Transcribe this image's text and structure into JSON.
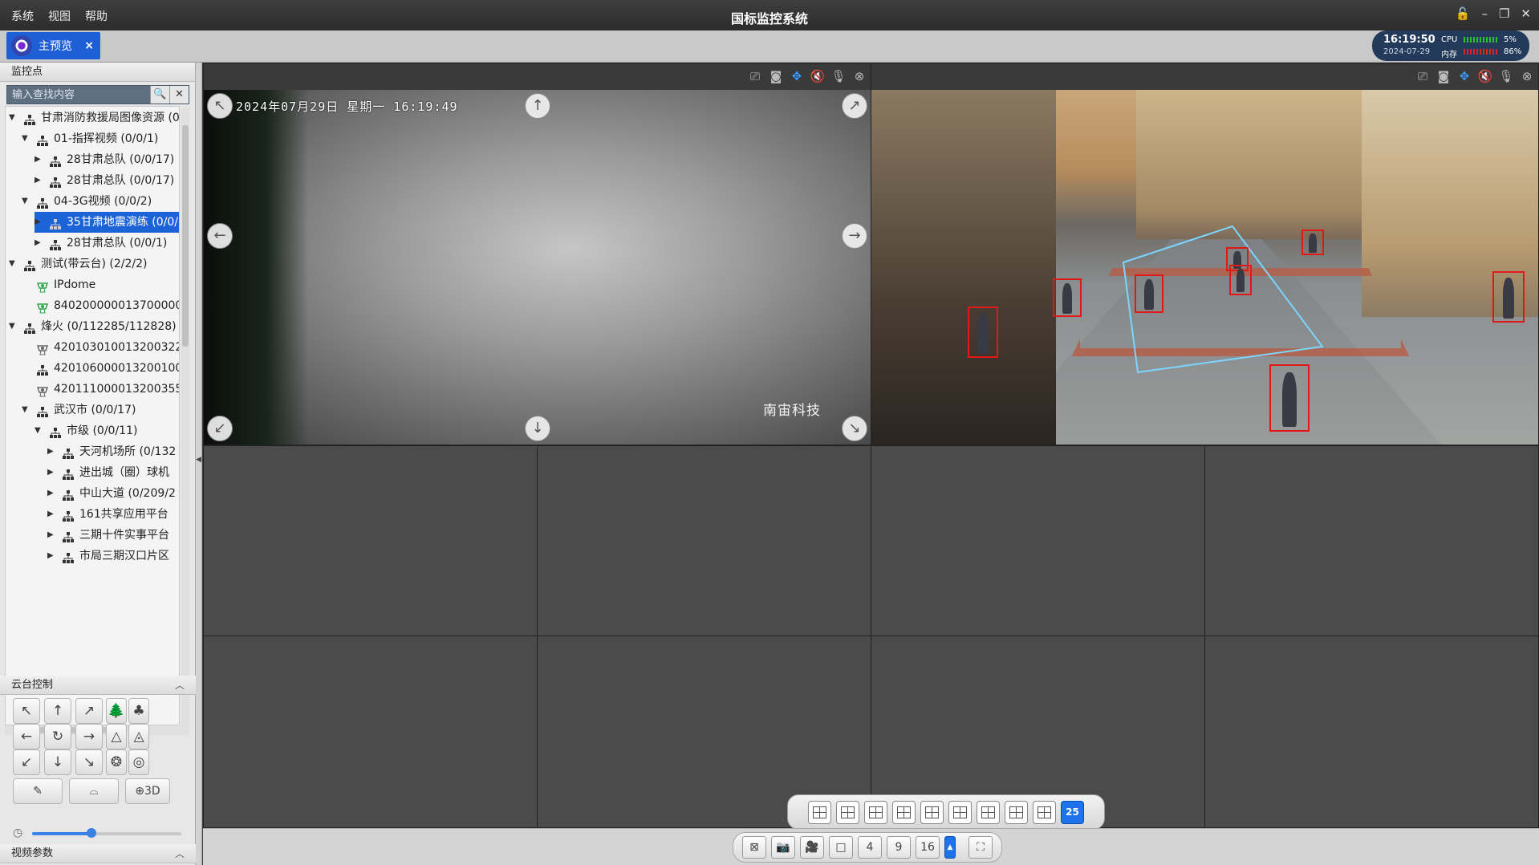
{
  "menu": [
    "系统",
    "视图",
    "帮助"
  ],
  "app_title": "国标监控系统",
  "window_controls": [
    "unlock-icon",
    "minimize-icon",
    "restore-icon",
    "close-icon"
  ],
  "tab": {
    "label": "主预览",
    "close": "×"
  },
  "status": {
    "time": "16:19:50",
    "date": "2024-07-29",
    "cpu_label": "CPU",
    "cpu_pct": "5%",
    "mem_label": "内存",
    "mem_pct": "86%"
  },
  "left": {
    "header": "监控点",
    "search_placeholder": "输入查找内容",
    "search_btn": "🔍",
    "clear_btn": "✕",
    "tree": [
      {
        "label": "甘肃消防救援局图像资源 (0/",
        "level": 0,
        "arrow": "▼",
        "icon": "org"
      },
      {
        "label": "01-指挥视频 (0/0/1)",
        "level": 1,
        "arrow": "▼",
        "icon": "org"
      },
      {
        "label": "28甘肃总队 (0/0/17)",
        "level": 2,
        "arrow": "▶",
        "icon": "org"
      },
      {
        "label": "28甘肃总队 (0/0/17)",
        "level": 2,
        "arrow": "▶",
        "icon": "org"
      },
      {
        "label": "04-3G视频 (0/0/2)",
        "level": 1,
        "arrow": "▼",
        "icon": "org"
      },
      {
        "label": "35甘肃地震演练 (0/0/",
        "level": 2,
        "arrow": "▶",
        "icon": "org",
        "selected": true
      },
      {
        "label": "28甘肃总队 (0/0/1)",
        "level": 2,
        "arrow": "▶",
        "icon": "org"
      },
      {
        "label": "测试(带云台) (2/2/2)",
        "level": 0,
        "arrow": "▼",
        "icon": "org"
      },
      {
        "label": "IPdome",
        "level": 1,
        "arrow": "",
        "icon": "cam-green"
      },
      {
        "label": "840200000013700000",
        "level": 1,
        "arrow": "",
        "icon": "cam-green"
      },
      {
        "label": "烽火 (0/112285/112828)",
        "level": 0,
        "arrow": "▼",
        "icon": "org"
      },
      {
        "label": "4201030100132003228",
        "level": 1,
        "arrow": "",
        "icon": "cam-gray"
      },
      {
        "label": "420106000013200100 (",
        "level": 1,
        "arrow": "",
        "icon": "org"
      },
      {
        "label": "4201110000132003554",
        "level": 1,
        "arrow": "",
        "icon": "cam-gray"
      },
      {
        "label": "武汉市 (0/0/17)",
        "level": 1,
        "arrow": "▼",
        "icon": "org"
      },
      {
        "label": "市级 (0/0/11)",
        "level": 2,
        "arrow": "▼",
        "icon": "org"
      },
      {
        "label": "天河机场所 (0/132",
        "level": 3,
        "arrow": "▶",
        "icon": "org"
      },
      {
        "label": "进出城（圈）球机",
        "level": 3,
        "arrow": "▶",
        "icon": "org"
      },
      {
        "label": "中山大道 (0/209/2",
        "level": 3,
        "arrow": "▶",
        "icon": "org"
      },
      {
        "label": "161共享应用平台",
        "level": 3,
        "arrow": "▶",
        "icon": "org"
      },
      {
        "label": "三期十件实事平台",
        "level": 3,
        "arrow": "▶",
        "icon": "org"
      },
      {
        "label": "市局三期汉口片区",
        "level": 3,
        "arrow": "▶",
        "icon": "org"
      }
    ],
    "ptz_header": "云台控制",
    "ptz_buttons": [
      {
        "name": "ptz-up-left",
        "glyph": "↖"
      },
      {
        "name": "ptz-up",
        "glyph": "↑"
      },
      {
        "name": "ptz-up-right",
        "glyph": "↗"
      },
      {
        "name": "ptz-zoom-in",
        "glyph": "🌲"
      },
      {
        "name": "ptz-zoom-out",
        "glyph": "♣"
      },
      {
        "name": "ptz-left",
        "glyph": "←"
      },
      {
        "name": "ptz-auto",
        "glyph": "↻"
      },
      {
        "name": "ptz-right",
        "glyph": "→"
      },
      {
        "name": "ptz-focus-near",
        "glyph": "△"
      },
      {
        "name": "ptz-focus-far",
        "glyph": "◬"
      },
      {
        "name": "ptz-down-left",
        "glyph": "↙"
      },
      {
        "name": "ptz-down",
        "glyph": "↓"
      },
      {
        "name": "ptz-down-right",
        "glyph": "↘"
      },
      {
        "name": "ptz-iris-open",
        "glyph": "❂"
      },
      {
        "name": "ptz-iris-close",
        "glyph": "◎"
      }
    ],
    "ptz_wide": [
      {
        "name": "ptz-light",
        "glyph": "✎"
      },
      {
        "name": "ptz-wiper",
        "glyph": "⌓"
      },
      {
        "name": "ptz-3d",
        "glyph": "⊕3D"
      }
    ],
    "speed": 0.4,
    "video_params_header": "视频参数"
  },
  "cells": {
    "toolbar_icons": [
      "record-icon",
      "snapshot-icon",
      "ptz-icon",
      "mute-icon",
      "mic-icon",
      "close-icon"
    ],
    "toolbar_glyphs": [
      "⎚",
      "◙",
      "✥",
      "🔇",
      "🎙",
      "⊗"
    ],
    "cam1": {
      "osd": "2024年07月29日  星期一  16:19:49",
      "watermark": "南宙科技"
    }
  },
  "layouts": [
    "1x2",
    "2x2a",
    "2x2",
    "1+3",
    "3x3a",
    "3x3",
    "1+5",
    "4x3",
    "4x4",
    "25"
  ],
  "active_layout_label": "25",
  "controls": [
    {
      "name": "stop-all-button",
      "glyph": "⊠"
    },
    {
      "name": "snapshot-all-button",
      "glyph": "📷"
    },
    {
      "name": "record-all-button",
      "glyph": "🎥"
    },
    {
      "name": "layout-1-button",
      "glyph": "□"
    },
    {
      "name": "layout-4-button",
      "glyph": "4"
    },
    {
      "name": "layout-9-button",
      "glyph": "9"
    },
    {
      "name": "layout-16-button",
      "glyph": "16"
    }
  ],
  "fullscreen": "⛶"
}
